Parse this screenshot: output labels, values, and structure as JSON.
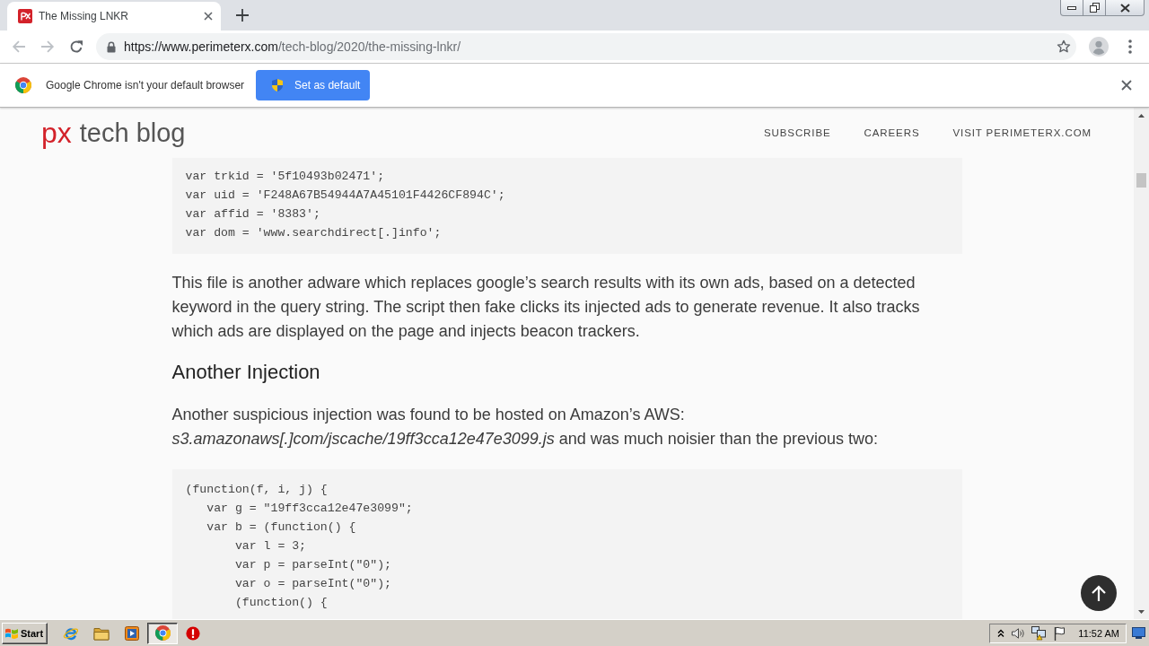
{
  "browser": {
    "tabs": [
      {
        "title": "The Missing LNKR",
        "selected": true
      }
    ],
    "nav_buttons": [
      {
        "kind": "back",
        "disabled": true
      },
      {
        "kind": "forward",
        "disabled": true
      },
      {
        "kind": "reload",
        "disabled": false
      }
    ],
    "address_bar": {
      "origin": "https://www.perimeterx.com",
      "path": "/tech-blog/2020/the-missing-lnkr/"
    }
  },
  "infobar": {
    "message": "Google Chrome isn't your default browser",
    "button": "Set as default"
  },
  "site_header": {
    "logo_mark": "px",
    "logo_text": "tech blog",
    "nav": [
      "SUBSCRIBE",
      "CAREERS",
      "VISIT PERIMETERX.COM"
    ]
  },
  "article": {
    "blocks": [
      {
        "kind": "code",
        "lines": [
          "var trkid = '5f10493b02471';",
          "var uid = 'F248A67B54944A7A45101F4426CF894C';",
          "var affid = '8383';",
          "var dom = 'www.searchdirect[.]info';"
        ]
      },
      {
        "kind": "paragraph",
        "text": "This file is another adware which replaces google’s search results with its own ads, based on a detected keyword in the query string. The script then fake clicks its injected ads to generate revenue. It also tracks which ads are displayed on the page and injects beacon trackers."
      },
      {
        "kind": "heading",
        "text": "Another Injection"
      },
      {
        "kind": "paragraph",
        "text": "Another suspicious injection was found to be hosted on Amazon’s AWS: *s3.amazonaws[.]com/jscache/19ff3cca12e47e3099.js* and was much noisier than the previous two:"
      },
      {
        "kind": "code",
        "lines": [
          "(function(f, i, j) {",
          "   var g = \"19ff3cca12e47e3099\";",
          "   var b = (function() {",
          "       var l = 3;",
          "       var p = parseInt(\"0\");",
          "       var o = parseInt(\"0\");",
          "       (function() {"
        ]
      }
    ]
  },
  "taskbar": {
    "start_label": "Start",
    "apps": [
      {
        "kind": "browser",
        "selected": false
      },
      {
        "kind": "folder",
        "selected": false
      },
      {
        "kind": "media",
        "selected": false
      },
      {
        "kind": "chrome",
        "selected": true
      },
      {
        "kind": "alert",
        "selected": false
      }
    ],
    "clock": "11:52 AM"
  }
}
